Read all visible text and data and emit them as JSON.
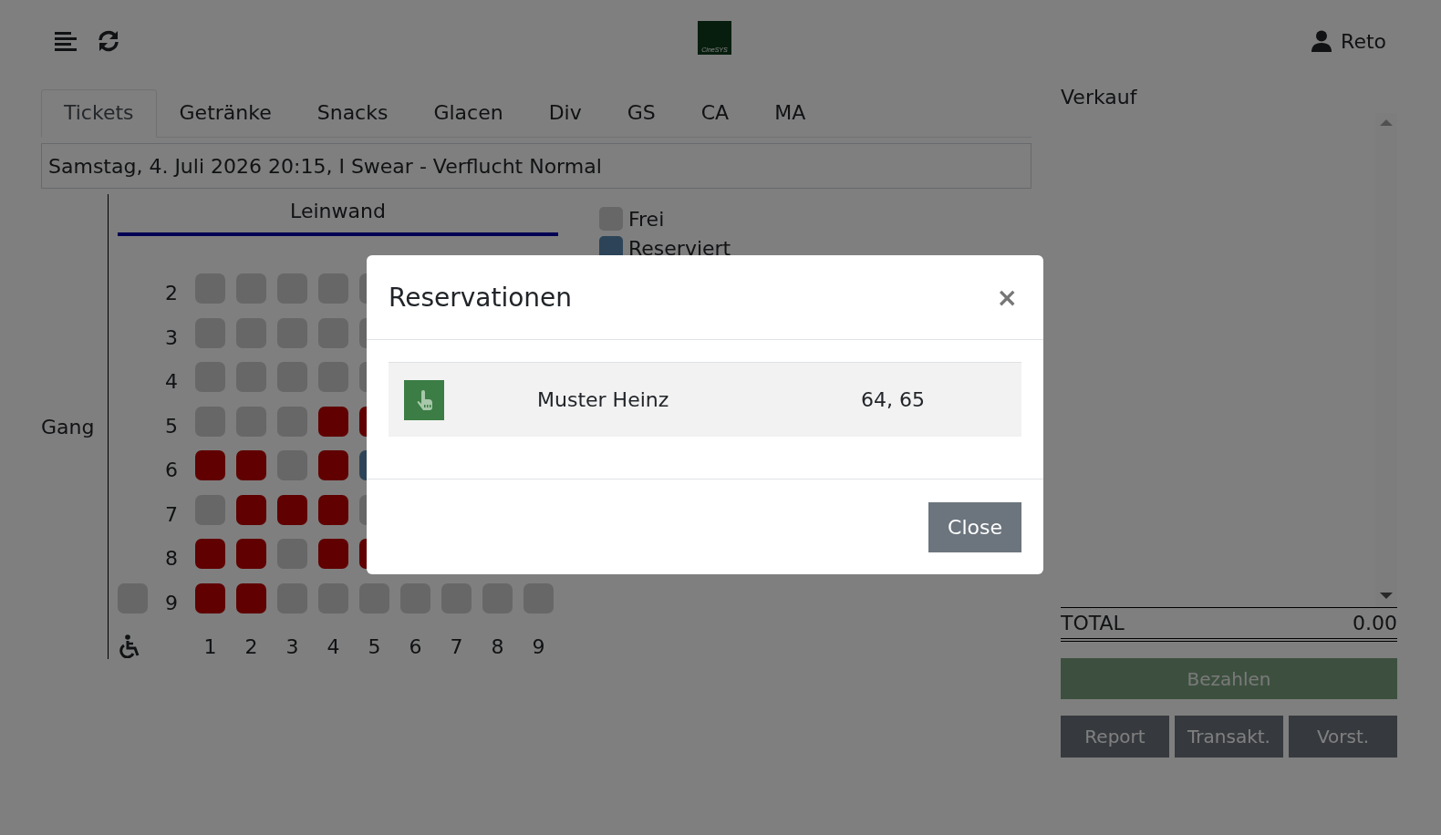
{
  "header": {
    "logo_text": "CineSYS",
    "user": "Reto"
  },
  "tabs": [
    {
      "label": "Tickets",
      "selected": true
    },
    {
      "label": "Getränke",
      "selected": false
    },
    {
      "label": "Snacks",
      "selected": false
    },
    {
      "label": "Glacen",
      "selected": false
    },
    {
      "label": "Div",
      "selected": false
    },
    {
      "label": "GS",
      "selected": false
    },
    {
      "label": "CA",
      "selected": false
    },
    {
      "label": "MA",
      "selected": false
    }
  ],
  "show_field": {
    "value": "Samstag, 4. Juli 2026 20:15, I Swear - Verflucht Normal"
  },
  "seat_plan": {
    "aisle_label": "Gang",
    "screen_label": "Leinwand",
    "legend": [
      {
        "label": "Frei",
        "kind": "free"
      },
      {
        "label": "Reserviert",
        "kind": "reserved"
      }
    ],
    "rows": [
      {
        "label": "2",
        "seats": [
          {
            "kind": "free"
          },
          {
            "kind": "free"
          },
          {
            "kind": "free"
          },
          {
            "kind": "free"
          },
          {
            "kind": "free"
          }
        ]
      },
      {
        "label": "3",
        "seats": [
          {
            "kind": "free"
          },
          {
            "kind": "free"
          },
          {
            "kind": "free"
          },
          {
            "kind": "free"
          },
          {
            "kind": "free"
          }
        ]
      },
      {
        "label": "4",
        "seats": [
          {
            "kind": "free"
          },
          {
            "kind": "free"
          },
          {
            "kind": "free"
          },
          {
            "kind": "free"
          },
          {
            "kind": "free"
          }
        ]
      },
      {
        "label": "5",
        "seats": [
          {
            "kind": "free"
          },
          {
            "kind": "free"
          },
          {
            "kind": "free"
          },
          {
            "kind": "sold"
          },
          {
            "kind": "sold"
          }
        ]
      },
      {
        "label": "6",
        "seats": [
          {
            "kind": "sold"
          },
          {
            "kind": "sold"
          },
          {
            "kind": "free"
          },
          {
            "kind": "sold"
          },
          {
            "kind": "reserved"
          }
        ]
      },
      {
        "label": "7",
        "seats": [
          {
            "kind": "free"
          },
          {
            "kind": "sold"
          },
          {
            "kind": "sold"
          },
          {
            "kind": "sold"
          },
          {
            "kind": "free"
          }
        ]
      },
      {
        "label": "8",
        "seats": [
          {
            "kind": "sold"
          },
          {
            "kind": "sold"
          },
          {
            "kind": "free"
          },
          {
            "kind": "sold"
          },
          {
            "kind": "sold"
          }
        ]
      },
      {
        "label": "9",
        "wheelchair_seat": {
          "kind": "free"
        },
        "seats": [
          {
            "kind": "sold"
          },
          {
            "kind": "sold"
          },
          {
            "kind": "free"
          },
          {
            "kind": "free"
          },
          {
            "kind": "free"
          },
          {
            "kind": "free"
          },
          {
            "kind": "free"
          },
          {
            "kind": "free"
          },
          {
            "kind": "free"
          }
        ]
      }
    ],
    "column_numbers": [
      "1",
      "2",
      "3",
      "4",
      "5",
      "6",
      "7",
      "8",
      "9"
    ]
  },
  "sale_panel": {
    "title": "Verkauf",
    "total_label": "TOTAL",
    "total_value": "0.00",
    "pay_button": {
      "label": "Bezahlen",
      "disabled": true
    },
    "buttons": [
      "Report",
      "Transakt.",
      "Vorst."
    ]
  },
  "modal": {
    "title": "Reservationen",
    "close_symbol": "×",
    "rows": [
      {
        "name": "Muster Heinz",
        "seats": "64, 65"
      }
    ],
    "close_button": "Close"
  }
}
